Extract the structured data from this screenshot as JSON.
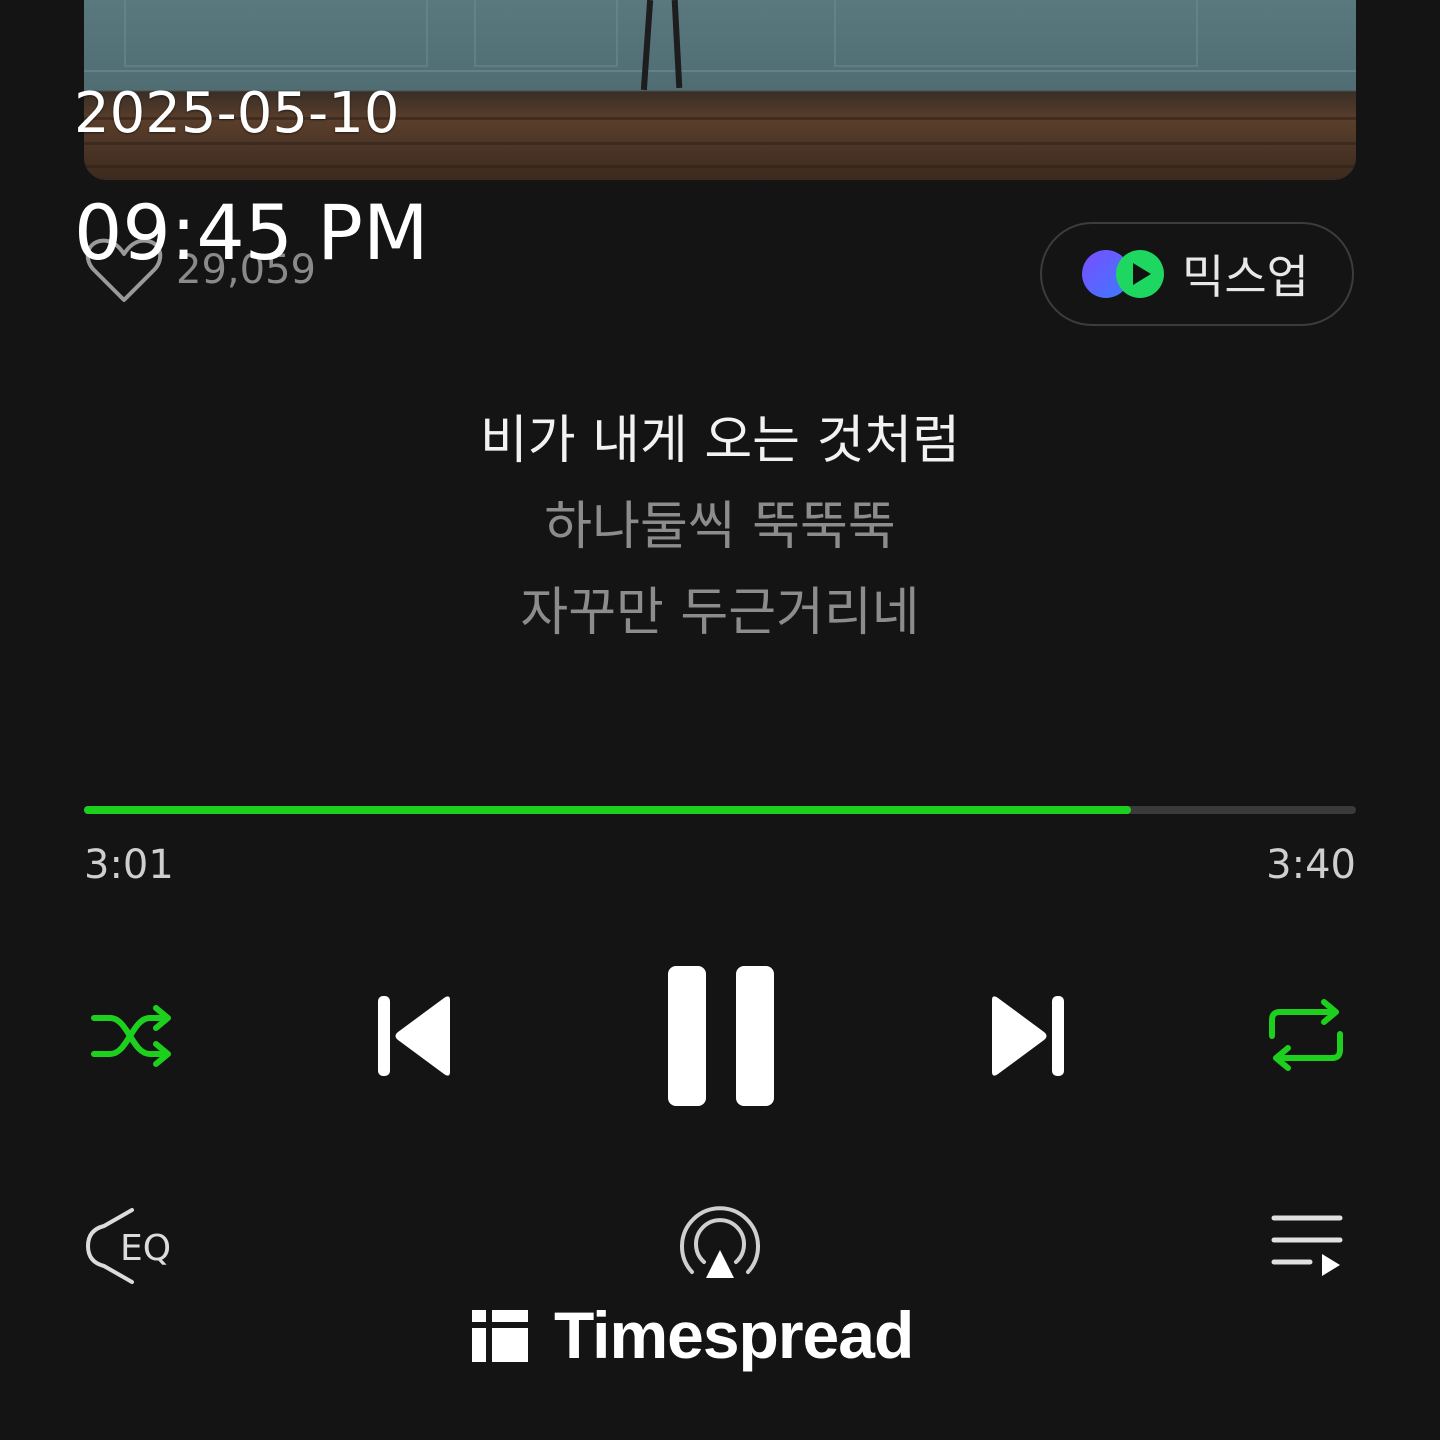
{
  "overlay": {
    "date": "2025-05-10",
    "time": "09:45 PM"
  },
  "track": {
    "like_count": "29,059"
  },
  "mixup": {
    "label": "믹스업"
  },
  "lyrics": [
    {
      "text": "비가 내게 오는 것처럼",
      "state": "current"
    },
    {
      "text": "하나둘씩 뚝뚝뚝",
      "state": "next"
    },
    {
      "text": "자꾸만 두근거리네",
      "state": "next"
    }
  ],
  "playback": {
    "elapsed": "3:01",
    "duration": "3:40",
    "progress": 0.823,
    "state": "playing"
  },
  "controls": {
    "shuffle": {
      "icon": "shuffle-icon",
      "active": true
    },
    "previous": {
      "icon": "skip-previous-icon"
    },
    "play_pause": {
      "icon": "pause-icon"
    },
    "next": {
      "icon": "skip-next-icon"
    },
    "repeat": {
      "icon": "repeat-icon",
      "active": true
    },
    "eq": {
      "icon": "eq-icon",
      "label": "EQ"
    },
    "cast": {
      "icon": "airplay-icon"
    },
    "playlist": {
      "icon": "playlist-icon"
    }
  },
  "watermark": {
    "brand": "Timespread"
  },
  "colors": {
    "accent": "#1ed01e",
    "background": "#141414"
  }
}
